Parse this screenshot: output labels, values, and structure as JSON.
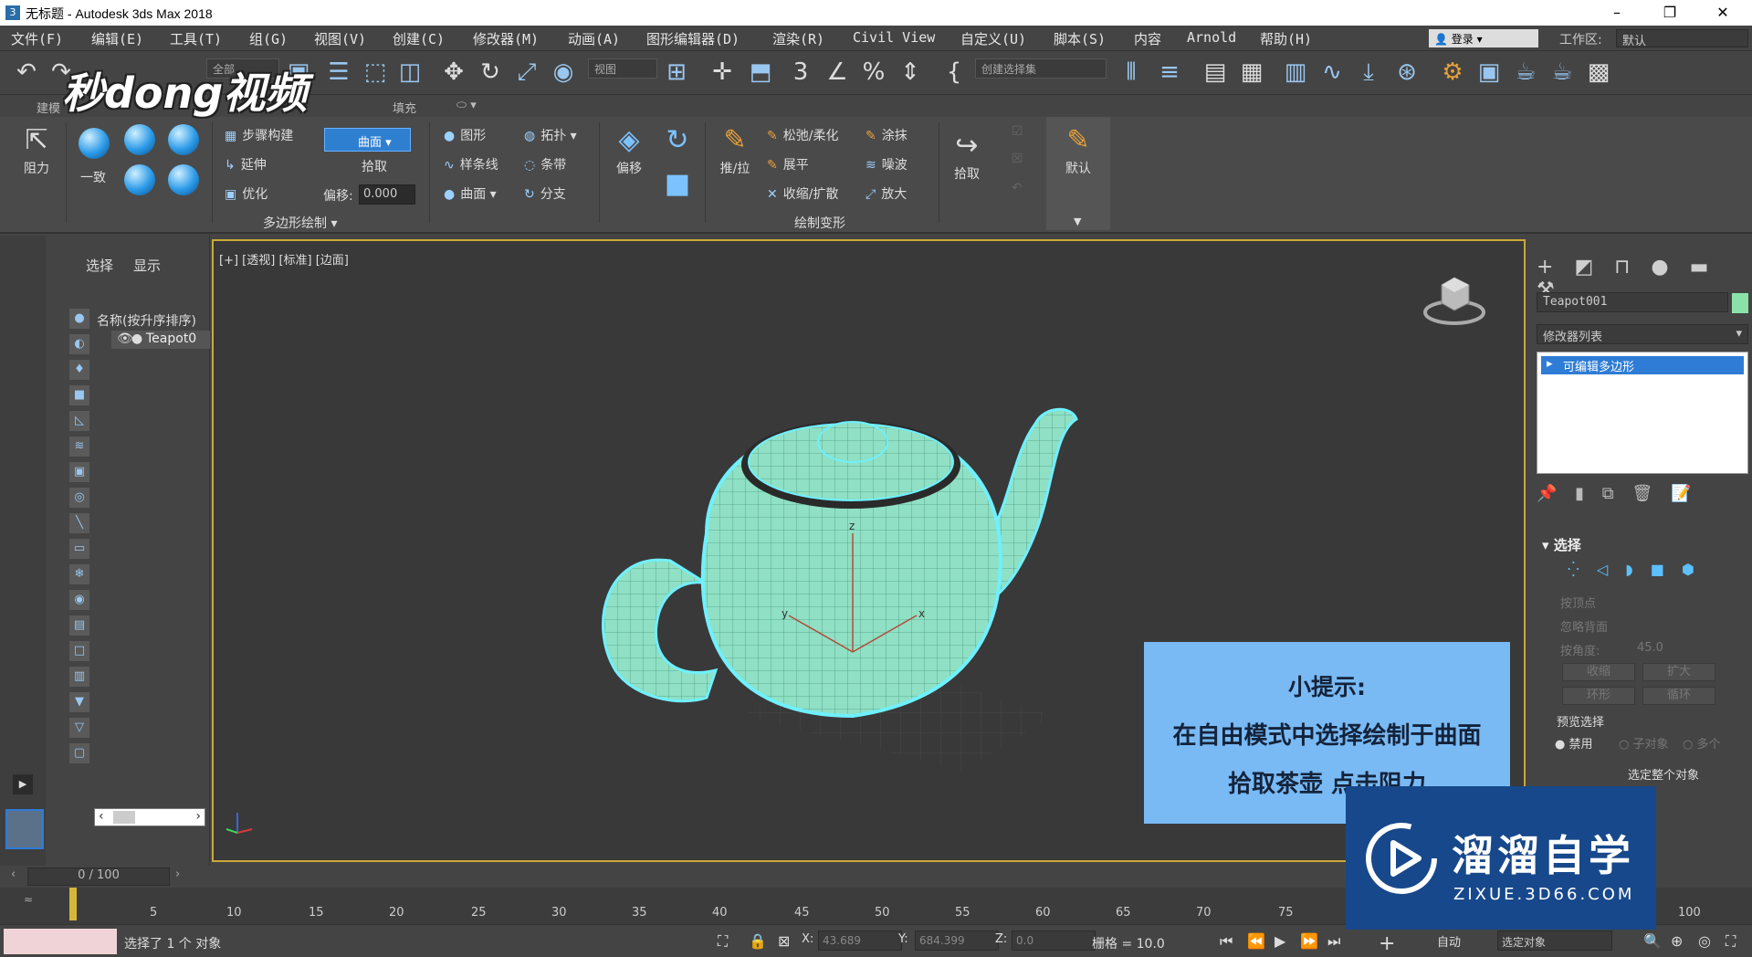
{
  "window": {
    "title": "无标题 - Autodesk 3ds Max 2018",
    "app_icon": "3ds-max-logo",
    "minimize": "–",
    "maximize": "❐",
    "close": "✕"
  },
  "menu": {
    "items": [
      "文件(F)",
      "编辑(E)",
      "工具(T)",
      "组(G)",
      "视图(V)",
      "创建(C)",
      "修改器(M)",
      "动画(A)",
      "图形编辑器(D)",
      "渲染(R)",
      "Civil View",
      "自定义(U)",
      "脚本(S)",
      "内容",
      "Arnold",
      "帮助(H)"
    ],
    "login": "登录",
    "workspace_label": "工作区:",
    "workspace_value": "默认"
  },
  "toolbar": {
    "filter_dropdown": "全部",
    "view_dropdown": "视图",
    "selection_set": "创建选择集"
  },
  "ribbon_tabs": [
    "建模",
    "填充"
  ],
  "ribbon": {
    "drag_label": "阻力",
    "conform_label": "一致",
    "step_build": "步骤构建",
    "extend": "延伸",
    "optimize": "优化",
    "curve_btn": "曲面",
    "pick_label": "拾取",
    "offset_label": "偏移:",
    "offset_value": "0.000",
    "shape": "图形",
    "topology": "拓扑",
    "spline": "样条线",
    "strip": "条带",
    "surface": "曲面",
    "branch": "分支",
    "polydraw_label": "多边形绘制",
    "offset_big": "偏移",
    "push_pull": "推/拉",
    "relax_soften": "松弛/柔化",
    "smudge": "涂抹",
    "flatten": "展平",
    "noise": "噪波",
    "shrink_expand": "收缩/扩散",
    "enlarge": "放大",
    "pick_big": "拾取",
    "paint_deform_label": "绘制变形",
    "default_label": "默认"
  },
  "scene_explorer": {
    "tab_select": "选择",
    "tab_display": "显示",
    "column_header": "名称(按升序排序)",
    "row_name": "Teapot0"
  },
  "viewport": {
    "label": "[+] [透视] [标准] [边面]",
    "axis_labels": [
      "z",
      "y",
      "x"
    ]
  },
  "tip": {
    "title": "小提示:",
    "line1": "在自由模式中选择绘制于曲面",
    "line2": "拾取茶壶 点击阻力"
  },
  "command_panel": {
    "object_name": "Teapot001",
    "object_color": "#8be2a9",
    "modifier_list": "修改器列表",
    "stack_item": "可编辑多边形",
    "selection_header": "选择",
    "by_vertex": "按顶点",
    "ignore_backfacing": "忽略背面",
    "by_angle": "按角度:",
    "angle_value": "45.0",
    "shrink": "收缩",
    "grow": "扩大",
    "ring": "环形",
    "loop": "循环",
    "preview_selection": "预览选择",
    "preview_disabled": "禁用",
    "preview_subobj": "子对象",
    "preview_multi": "多个",
    "select_whole": "选定整个对象"
  },
  "timeline": {
    "frame": "0 / 100",
    "ticks": [
      "5",
      "10",
      "15",
      "20",
      "25",
      "30",
      "35",
      "40",
      "45",
      "50",
      "55",
      "60",
      "65",
      "70",
      "75",
      "100"
    ]
  },
  "status": {
    "selected": "选择了 1 个 对象",
    "x_label": "X:",
    "x_value": "43.689",
    "y_label": "Y:",
    "y_value": "684.399",
    "z_label": "Z:",
    "z_value": "0.0",
    "grid": "栅格 = 10.0",
    "auto": "自动",
    "selected_object": "选定对象"
  },
  "watermarks": {
    "top_left": "秒dong视频",
    "brand_title": "溜溜自学",
    "brand_sub": "ZIXUE.3D66.COM"
  }
}
